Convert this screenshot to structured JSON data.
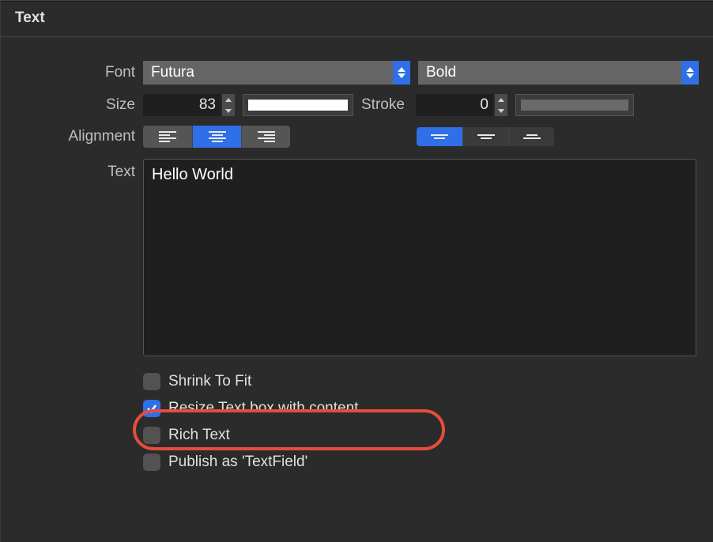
{
  "panel": {
    "title": "Text"
  },
  "labels": {
    "font": "Font",
    "size": "Size",
    "stroke": "Stroke",
    "alignment": "Alignment",
    "text": "Text"
  },
  "font": {
    "family": "Futura",
    "weight": "Bold"
  },
  "size": {
    "value": "83"
  },
  "fill_color": "#ffffff",
  "stroke": {
    "value": "0",
    "color": "#6a6a6a"
  },
  "horizontal_alignment": {
    "selected": "center"
  },
  "vertical_alignment": {
    "selected": "top"
  },
  "text_value": "Hello World",
  "checkboxes": {
    "shrink_to_fit": {
      "label": "Shrink To Fit",
      "checked": false
    },
    "resize_with_content": {
      "label": "Resize Text box with content",
      "checked": true
    },
    "rich_text": {
      "label": "Rich Text",
      "checked": false
    },
    "publish_textfield": {
      "label": "Publish as 'TextField'",
      "checked": false
    }
  }
}
